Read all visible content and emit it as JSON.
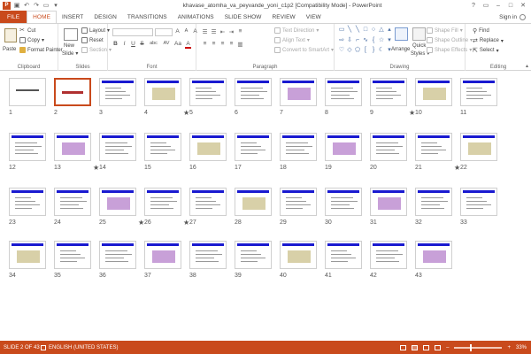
{
  "window": {
    "title": "khavase_atomha_va_peyvande_yoni_c1p2 [Compatibility Mode] - PowerPoint",
    "app_logo": "P",
    "controls": [
      "?",
      "▭",
      "–",
      "□",
      "✕"
    ]
  },
  "tabs": [
    "FILE",
    "HOME",
    "INSERT",
    "DESIGN",
    "TRANSITIONS",
    "ANIMATIONS",
    "SLIDE SHOW",
    "REVIEW",
    "VIEW"
  ],
  "active_tab": "HOME",
  "sign_in": "Sign in",
  "ribbon": {
    "clipboard": {
      "label": "Clipboard",
      "paste": "Paste",
      "cut": "Cut",
      "copy": "Copy",
      "format_painter": "Format Painter"
    },
    "slides": {
      "label": "Slides",
      "new_slide": "New",
      "new_slide_2": "Slide",
      "layout": "Layout",
      "reset": "Reset",
      "section": "Section"
    },
    "font": {
      "label": "Font",
      "bold": "B",
      "italic": "I",
      "underline": "U",
      "strike": "S",
      "shadow": "abc",
      "spacing": "AV",
      "case": "Aa",
      "color": "A",
      "grow": "A",
      "shrink": "A",
      "clear": "A"
    },
    "paragraph": {
      "label": "Paragraph",
      "text_direction": "Text Direction",
      "align_text": "Align Text",
      "convert": "Convert to SmartArt"
    },
    "drawing": {
      "label": "Drawing",
      "arrange": "Arrange",
      "quick_styles": "Quick",
      "quick_styles_2": "Styles",
      "fill": "Shape Fill",
      "outline": "Shape Outline",
      "effects": "Shape Effects"
    },
    "editing": {
      "label": "Editing",
      "find": "Find",
      "replace": "Replace",
      "select": "Select"
    }
  },
  "slides": [
    {
      "n": "1"
    },
    {
      "n": "2",
      "selected": true
    },
    {
      "n": "3"
    },
    {
      "n": "4",
      "star": true
    },
    {
      "n": "5"
    },
    {
      "n": "6"
    },
    {
      "n": "7"
    },
    {
      "n": "8"
    },
    {
      "n": "9",
      "star": true
    },
    {
      "n": "10"
    },
    {
      "n": "11"
    },
    {
      "n": "12"
    },
    {
      "n": "13",
      "star": true
    },
    {
      "n": "14"
    },
    {
      "n": "15"
    },
    {
      "n": "16"
    },
    {
      "n": "17"
    },
    {
      "n": "18"
    },
    {
      "n": "19"
    },
    {
      "n": "20"
    },
    {
      "n": "21",
      "star": true
    },
    {
      "n": "22"
    },
    {
      "n": "23"
    },
    {
      "n": "24"
    },
    {
      "n": "25",
      "star": true
    },
    {
      "n": "26",
      "star": true
    },
    {
      "n": "27"
    },
    {
      "n": "28"
    },
    {
      "n": "29"
    },
    {
      "n": "30"
    },
    {
      "n": "31"
    },
    {
      "n": "32"
    },
    {
      "n": "33"
    },
    {
      "n": "34"
    },
    {
      "n": "35"
    },
    {
      "n": "36"
    },
    {
      "n": "37"
    },
    {
      "n": "38"
    },
    {
      "n": "39"
    },
    {
      "n": "40"
    },
    {
      "n": "41"
    },
    {
      "n": "42"
    },
    {
      "n": "43"
    }
  ],
  "star_glyph": "★",
  "status": {
    "slide_info": "SLIDE 2 OF 43",
    "language": "ENGLISH (UNITED STATES)",
    "zoom_minus": "–",
    "zoom_plus": "+",
    "zoom": "33%",
    "zoom_fraction": 0.33
  },
  "colors": {
    "accent": "#c94a1c",
    "slide_title_bar": "#1a1ad0"
  }
}
